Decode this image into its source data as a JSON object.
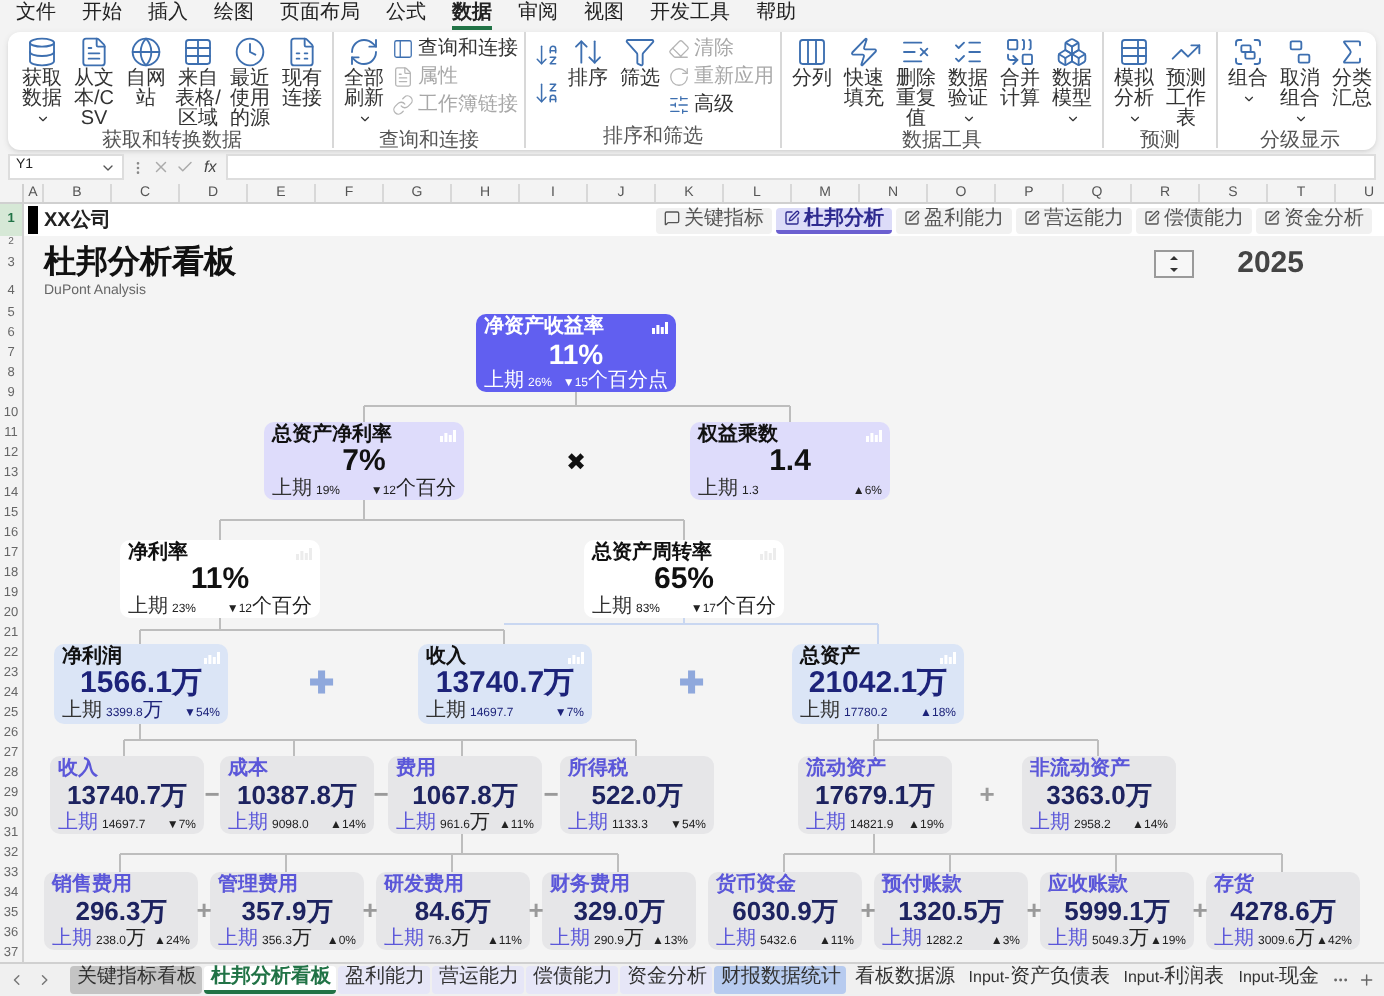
{
  "menu_tabs": [
    {
      "label": "文件",
      "selected": false
    },
    {
      "label": "开始",
      "selected": false
    },
    {
      "label": "插入",
      "selected": false
    },
    {
      "label": "绘图",
      "selected": false
    },
    {
      "label": "页面布局",
      "selected": false
    },
    {
      "label": "公式",
      "selected": false
    },
    {
      "label": "数据",
      "selected": true
    },
    {
      "label": "审阅",
      "selected": false
    },
    {
      "label": "视图",
      "selected": false
    },
    {
      "label": "开发工具",
      "selected": false
    },
    {
      "label": "帮助",
      "selected": false
    }
  ],
  "ribbon_groups": [
    {
      "label": "获取和转换数据",
      "items": [
        {
          "kind": "large",
          "label": "获取数据",
          "dropdown": true,
          "disabled": false
        },
        {
          "kind": "large",
          "label": "从文本/CSV",
          "dropdown": false,
          "disabled": false
        },
        {
          "kind": "large",
          "label": "自网站",
          "dropdown": false,
          "disabled": false
        },
        {
          "kind": "large",
          "label": "来自表格/区域",
          "dropdown": false,
          "disabled": false
        },
        {
          "kind": "large",
          "label": "最近使用的源",
          "dropdown": false,
          "disabled": false
        },
        {
          "kind": "large",
          "label": "现有连接",
          "dropdown": false,
          "disabled": false
        }
      ]
    },
    {
      "label": "查询和连接",
      "items": [
        {
          "kind": "large",
          "label": "全部刷新",
          "dropdown": true,
          "disabled": false
        },
        {
          "kind": "small",
          "label": "查询和连接",
          "disabled": false
        },
        {
          "kind": "small",
          "label": "属性",
          "disabled": true
        },
        {
          "kind": "small",
          "label": "工作簿链接",
          "disabled": true
        }
      ]
    },
    {
      "label": "排序和筛选",
      "items": [
        {
          "kind": "icon",
          "disabled": false
        },
        {
          "kind": "icon",
          "disabled": false
        },
        {
          "kind": "large",
          "label": "排序",
          "dropdown": false,
          "disabled": false
        },
        {
          "kind": "large",
          "label": "筛选",
          "dropdown": false,
          "disabled": false
        },
        {
          "kind": "small",
          "label": "清除",
          "disabled": true
        },
        {
          "kind": "small",
          "label": "重新应用",
          "disabled": true
        },
        {
          "kind": "small",
          "label": "高级",
          "disabled": false
        }
      ]
    },
    {
      "label": "数据工具",
      "items": [
        {
          "kind": "large",
          "label": "分列",
          "dropdown": false,
          "disabled": false
        },
        {
          "kind": "large",
          "label": "快速填充",
          "dropdown": false,
          "disabled": false
        },
        {
          "kind": "large",
          "label": "删除重复值",
          "dropdown": false,
          "disabled": false
        },
        {
          "kind": "large",
          "label": "数据验证",
          "dropdown": true,
          "disabled": false
        },
        {
          "kind": "large",
          "label": "合并计算",
          "dropdown": false,
          "disabled": false
        },
        {
          "kind": "large",
          "label": "数据模型",
          "dropdown": true,
          "disabled": false
        }
      ]
    },
    {
      "label": "预测",
      "items": [
        {
          "kind": "large",
          "label": "模拟分析",
          "dropdown": true,
          "disabled": false
        },
        {
          "kind": "large",
          "label": "预测工作表",
          "dropdown": false,
          "disabled": false
        }
      ]
    },
    {
      "label": "分级显示",
      "items": [
        {
          "kind": "large",
          "label": "组合",
          "dropdown": true,
          "disabled": false
        },
        {
          "kind": "large",
          "label": "取消组合",
          "dropdown": true,
          "disabled": false
        },
        {
          "kind": "large",
          "label": "分类汇总",
          "dropdown": false,
          "disabled": false
        }
      ]
    }
  ],
  "formula_bar": {
    "name_box": "Y1",
    "function_label": "fx"
  },
  "column_headers": [
    "A",
    "B",
    "C",
    "D",
    "E",
    "F",
    "G",
    "H",
    "I",
    "J",
    "K",
    "L",
    "M",
    "N",
    "O",
    "P",
    "Q",
    "R",
    "S",
    "T",
    "U"
  ],
  "row_headers": [
    {
      "label": "1",
      "selected": true
    },
    {
      "label": "2",
      "selected": false
    },
    {
      "label": "3",
      "selected": false
    },
    {
      "label": "4",
      "selected": false
    },
    {
      "label": "5",
      "selected": false
    },
    {
      "label": "6",
      "selected": false
    },
    {
      "label": "7",
      "selected": false
    },
    {
      "label": "8",
      "selected": false
    },
    {
      "label": "9",
      "selected": false
    },
    {
      "label": "10",
      "selected": false
    },
    {
      "label": "11",
      "selected": false
    },
    {
      "label": "12",
      "selected": false
    },
    {
      "label": "13",
      "selected": false
    },
    {
      "label": "14",
      "selected": false
    },
    {
      "label": "15",
      "selected": false
    },
    {
      "label": "16",
      "selected": false
    },
    {
      "label": "17",
      "selected": false
    },
    {
      "label": "18",
      "selected": false
    },
    {
      "label": "19",
      "selected": false
    },
    {
      "label": "20",
      "selected": false
    },
    {
      "label": "21",
      "selected": false
    },
    {
      "label": "22",
      "selected": false
    },
    {
      "label": "23",
      "selected": false
    },
    {
      "label": "24",
      "selected": false
    },
    {
      "label": "25",
      "selected": false
    },
    {
      "label": "26",
      "selected": false
    },
    {
      "label": "27",
      "selected": false
    },
    {
      "label": "28",
      "selected": false
    },
    {
      "label": "29",
      "selected": false
    },
    {
      "label": "30",
      "selected": false
    },
    {
      "label": "31",
      "selected": false
    },
    {
      "label": "32",
      "selected": false
    },
    {
      "label": "33",
      "selected": false
    },
    {
      "label": "34",
      "selected": false
    },
    {
      "label": "35",
      "selected": false
    },
    {
      "label": "36",
      "selected": false
    },
    {
      "label": "37",
      "selected": false
    }
  ],
  "sheet": {
    "company": "XX公司",
    "nav_buttons": [
      {
        "label": "关键指标",
        "selected": false
      },
      {
        "label": "杜邦分析",
        "selected": true
      },
      {
        "label": "盈利能力",
        "selected": false
      },
      {
        "label": "营运能力",
        "selected": false
      },
      {
        "label": "偿债能力",
        "selected": false
      },
      {
        "label": "资金分析",
        "selected": false
      }
    ],
    "title": "杜邦分析看板",
    "subtitle": "DuPont Analysis",
    "year": "2025",
    "cards": [
      {
        "kind": "primary",
        "title": "净资产收益率",
        "value": "11%",
        "prior_label": "上期",
        "prior": "26%",
        "change": "▼15个百分点"
      },
      {
        "kind": "lavender",
        "title": "总资产净利率",
        "value": "7%",
        "prior_label": "上期",
        "prior": "19%",
        "change": "▼12个百分"
      },
      {
        "kind": "lavender",
        "title": "权益乘数",
        "value": "1.4",
        "prior_label": "上期",
        "prior": "1.3",
        "change": "▲6%"
      },
      {
        "kind": "plain",
        "title": "净利率",
        "value": "11%",
        "prior_label": "上期",
        "prior": "23%",
        "change": "▼12个百分"
      },
      {
        "kind": "plain",
        "title": "总资产周转率",
        "value": "65%",
        "prior_label": "上期",
        "prior": "83%",
        "change": "▼17个百分"
      },
      {
        "kind": "blue",
        "title": "净利润",
        "value": "1566.1万",
        "prior_label": "上期",
        "prior": "3399.8万",
        "change": "▼54%"
      },
      {
        "kind": "blue",
        "title": "收入",
        "value": "13740.7万",
        "prior_label": "上期",
        "prior": "14697.7",
        "change": "▼7%"
      },
      {
        "kind": "blue",
        "title": "总资产",
        "value": "21042.1万",
        "prior_label": "上期",
        "prior": "17780.2",
        "change": "▲18%"
      },
      {
        "kind": "gray",
        "title": "收入",
        "value": "13740.7万",
        "prior_label": "上期",
        "prior": "14697.7",
        "change": "▼7%"
      },
      {
        "kind": "gray",
        "title": "成本",
        "value": "10387.8万",
        "prior_label": "上期",
        "prior": "9098.0",
        "change": "▲14%"
      },
      {
        "kind": "gray",
        "title": "费用",
        "value": "1067.8万",
        "prior_label": "上期",
        "prior": "961.6万",
        "change": "▲11%"
      },
      {
        "kind": "gray",
        "title": "所得税",
        "value": "522.0万",
        "prior_label": "上期",
        "prior": "1133.3",
        "change": "▼54%"
      },
      {
        "kind": "gray",
        "title": "流动资产",
        "value": "17679.1万",
        "prior_label": "上期",
        "prior": "14821.9",
        "change": "▲19%"
      },
      {
        "kind": "gray",
        "title": "非流动资产",
        "value": "3363.0万",
        "prior_label": "上期",
        "prior": "2958.2",
        "change": "▲14%"
      },
      {
        "kind": "gray",
        "title": "销售费用",
        "value": "296.3万",
        "prior_label": "上期",
        "prior": "238.0万",
        "change": "▲24%"
      },
      {
        "kind": "gray",
        "title": "管理费用",
        "value": "357.9万",
        "prior_label": "上期",
        "prior": "356.3万",
        "change": "▲0%"
      },
      {
        "kind": "gray",
        "title": "研发费用",
        "value": "84.6万",
        "prior_label": "上期",
        "prior": "76.3万",
        "change": "▲11%"
      },
      {
        "kind": "gray",
        "title": "财务费用",
        "value": "329.0万",
        "prior_label": "上期",
        "prior": "290.9万",
        "change": "▲13%"
      },
      {
        "kind": "gray",
        "title": "货币资金",
        "value": "6030.9万",
        "prior_label": "上期",
        "prior": "5432.6",
        "change": "▲11%"
      },
      {
        "kind": "gray",
        "title": "预付账款",
        "value": "1320.5万",
        "prior_label": "上期",
        "prior": "1282.2",
        "change": "▲3%"
      },
      {
        "kind": "gray",
        "title": "应收账款",
        "value": "5999.1万",
        "prior_label": "上期",
        "prior": "5049.3万",
        "change": "▲19%"
      },
      {
        "kind": "gray",
        "title": "存货",
        "value": "4278.6万",
        "prior_label": "上期",
        "prior": "3009.6万",
        "change": "▲42%"
      }
    ],
    "operators": [
      {
        "kind": "dark",
        "symbol": "✖"
      },
      {
        "kind": "blue",
        "symbol": "✚"
      },
      {
        "kind": "blue",
        "symbol": "✚"
      },
      {
        "kind": "gray",
        "symbol": "−"
      },
      {
        "kind": "gray",
        "symbol": "−"
      },
      {
        "kind": "gray",
        "symbol": "−"
      },
      {
        "kind": "gray",
        "symbol": "+"
      },
      {
        "kind": "gray",
        "symbol": "+"
      },
      {
        "kind": "gray",
        "symbol": "+"
      },
      {
        "kind": "gray",
        "symbol": "+"
      },
      {
        "kind": "gray",
        "symbol": "+"
      },
      {
        "kind": "gray",
        "symbol": "+"
      },
      {
        "kind": "gray",
        "symbol": "+"
      }
    ]
  },
  "sheet_tabs": [
    {
      "label": "关键指标看板",
      "selected": false,
      "color": "#c4c4c4"
    },
    {
      "label": "杜邦分析看板",
      "selected": true
    },
    {
      "label": "盈利能力",
      "selected": false,
      "color": "#e6e6f7"
    },
    {
      "label": "营运能力",
      "selected": false,
      "color": "#e6e6f7"
    },
    {
      "label": "偿债能力",
      "selected": false,
      "color": "#e6e6f7"
    },
    {
      "label": "资金分析",
      "selected": false,
      "color": "#e6e6f7"
    },
    {
      "label": "财报数据统计",
      "selected": false,
      "color": "#b7cbef"
    },
    {
      "label": "看板数据源",
      "selected": false
    },
    {
      "label": "Input-资产负债表",
      "selected": false
    },
    {
      "label": "Input-利润表",
      "selected": false
    },
    {
      "label": "Input-现金",
      "selected": false
    }
  ]
}
